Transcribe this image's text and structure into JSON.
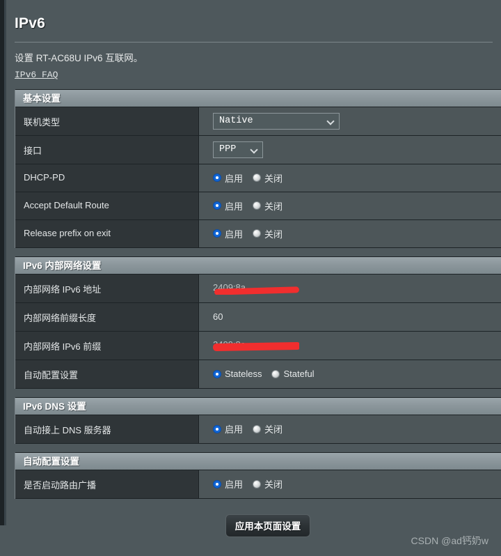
{
  "page": {
    "title": "IPv6",
    "description": "设置 RT-AC68U IPv6 互联网。",
    "faq_link": "IPv6  FAQ"
  },
  "colors": {
    "background": "#4e585c",
    "label_cell": "#2f3538",
    "value_cell": "#4d5659",
    "section_header_top": "#9aa5aa",
    "radio_selected": "#1266d6",
    "redaction": "#f12e2e"
  },
  "radio_labels": {
    "enable": "启用",
    "disable": "关闭",
    "stateless": "Stateless",
    "stateful": "Stateful"
  },
  "sections": [
    {
      "header": "基本设置",
      "rows": [
        {
          "label": "联机类型",
          "type": "select",
          "value": "Native",
          "width": "wide"
        },
        {
          "label": "接口",
          "type": "select",
          "value": "PPP",
          "width": "narrow"
        },
        {
          "label": "DHCP-PD",
          "type": "radio-enable",
          "selected": "enable"
        },
        {
          "label": "Accept Default Route",
          "type": "radio-enable",
          "selected": "enable"
        },
        {
          "label": "Release prefix on exit",
          "type": "radio-enable",
          "selected": "enable"
        }
      ]
    },
    {
      "header": "IPv6 内部网络设置",
      "rows": [
        {
          "label": "内部网络 IPv6 地址",
          "type": "redacted",
          "value": "2409:8a...",
          "scribble": "s1"
        },
        {
          "label": "内部网络前缀长度",
          "type": "text",
          "value": "60"
        },
        {
          "label": "内部网络 IPv6 前缀",
          "type": "redacted",
          "value": "2409:8a...",
          "scribble": "s2"
        },
        {
          "label": "自动配置设置",
          "type": "radio-state",
          "selected": "stateless"
        }
      ]
    },
    {
      "header": "IPv6 DNS 设置",
      "rows": [
        {
          "label": "自动接上 DNS 服务器",
          "type": "radio-enable",
          "selected": "enable"
        }
      ]
    },
    {
      "header": "自动配置设置",
      "rows": [
        {
          "label": "是否启动路由广播",
          "type": "radio-enable",
          "selected": "enable"
        }
      ]
    }
  ],
  "footer": {
    "apply_button": "应用本页面设置",
    "watermark": "CSDN @ad钙奶w"
  }
}
